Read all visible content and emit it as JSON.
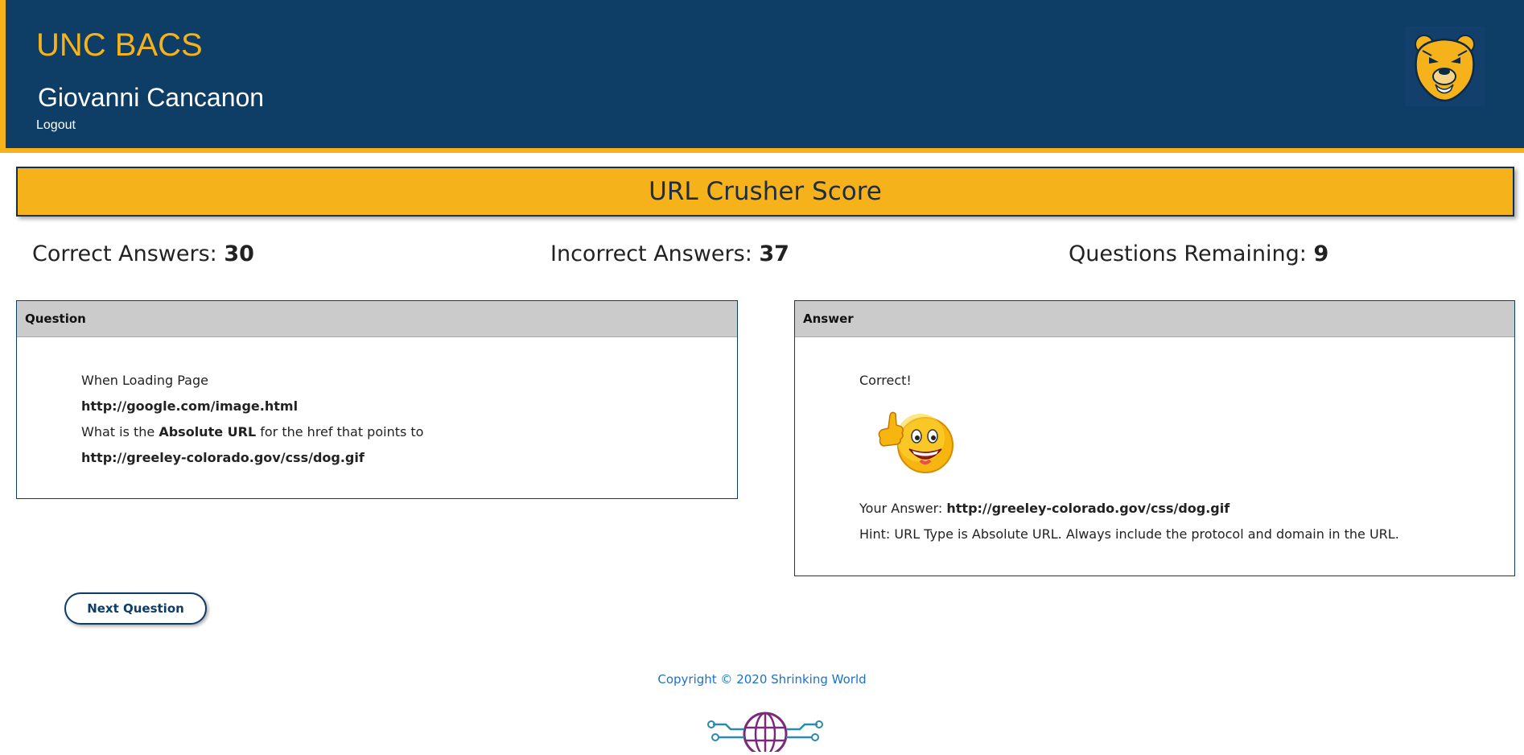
{
  "header": {
    "brand": "UNC BACS",
    "user_name": "Giovanni Cancanon",
    "logout_label": "Logout"
  },
  "score": {
    "title": "URL Crusher Score",
    "correct_label": "Correct Answers: ",
    "correct_value": "30",
    "incorrect_label": "Incorrect Answers: ",
    "incorrect_value": "37",
    "remaining_label": "Questions Remaining: ",
    "remaining_value": "9"
  },
  "question": {
    "heading": "Question",
    "line1": "When Loading Page",
    "page_url": "http://google.com/image.html",
    "prompt_prefix": "What is the ",
    "prompt_bold": "Absolute URL",
    "prompt_suffix": " for the href that points to",
    "target_url": "http://greeley-colorado.gov/css/dog.gif"
  },
  "answer": {
    "heading": "Answer",
    "result": "Correct!",
    "your_answer_label": "Your Answer: ",
    "your_answer_value": "http://greeley-colorado.gov/css/dog.gif",
    "hint": "Hint: URL Type is Absolute URL. Always include the protocol and domain in the URL."
  },
  "actions": {
    "next_label": "Next Question"
  },
  "footer": {
    "copyright": "Copyright © 2020 Shrinking World"
  },
  "colors": {
    "navy": "#0e3d66",
    "gold": "#f5b21a",
    "link_blue": "#1a73c8"
  },
  "icons": {
    "logo": "bear-head-logo-icon",
    "result": "thumbs-up-smiley-icon",
    "footer_logo": "globe-circuit-icon"
  }
}
